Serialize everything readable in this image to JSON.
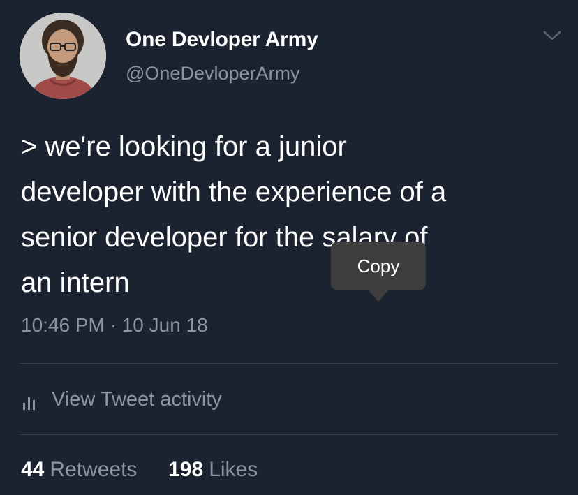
{
  "user": {
    "display_name": "One Devloper Army",
    "handle": "@OneDevloperArmy"
  },
  "tweet": {
    "text": "> we're looking for a junior\ndeveloper with the experience of a\nsenior developer for the salary of\nan intern",
    "timestamp": "10:46 PM · 10 Jun 18"
  },
  "activity": {
    "label": "View Tweet activity"
  },
  "stats": {
    "retweets_count": "44",
    "retweets_label": "Retweets",
    "likes_count": "198",
    "likes_label": "Likes"
  },
  "popup": {
    "label": "Copy"
  },
  "icons": {
    "caret": "chevron-down-icon",
    "activity": "bar-chart-icon"
  },
  "colors": {
    "background": "#1c2330",
    "primary_text": "#ffffff",
    "secondary_text": "#8a95a3",
    "divider": "#343d4b",
    "popup_bg": "#3d3d3d"
  }
}
